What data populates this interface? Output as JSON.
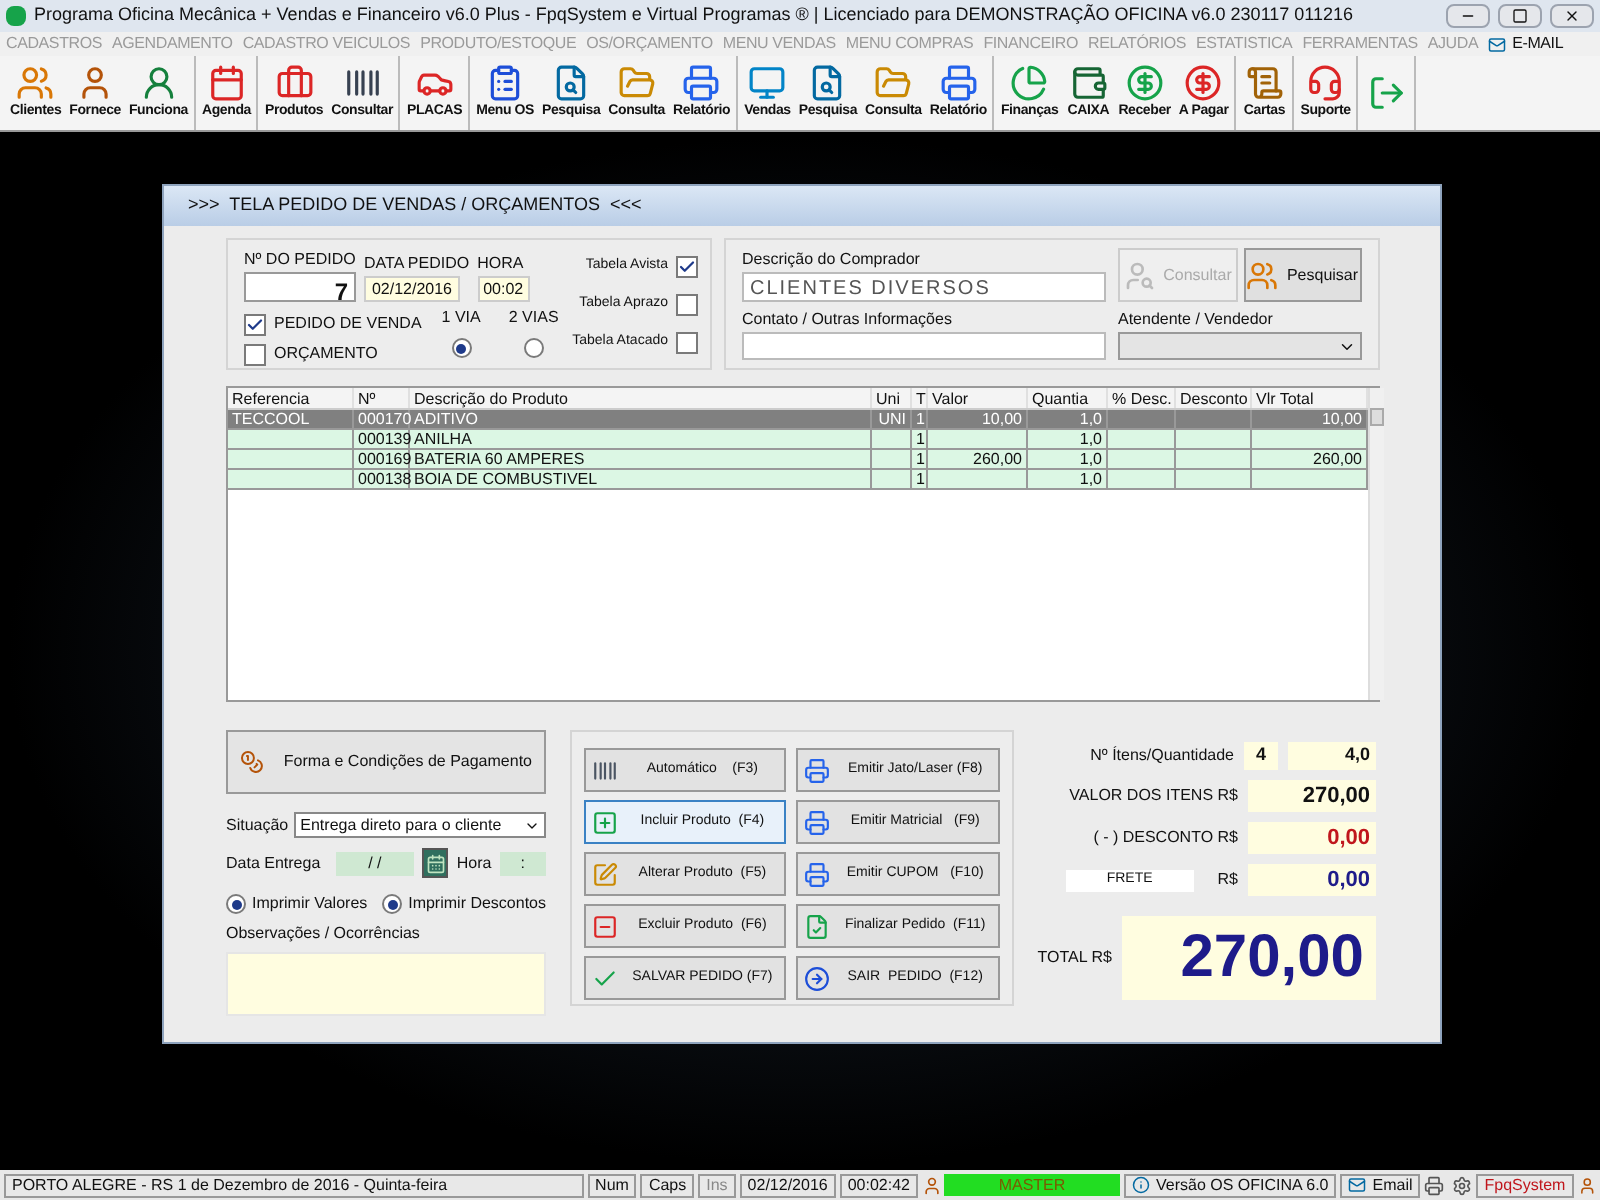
{
  "window": {
    "title": "Programa Oficina Mecânica + Vendas e Financeiro v6.0 Plus - FpqSystem e Virtual Programas ® | Licenciado para  DEMONSTRAÇÃO OFICINA v6.0 230117 011216"
  },
  "menu": [
    "CADASTROS",
    "AGENDAMENTO",
    "CADASTRO VEICULOS",
    "PRODUTO/ESTOQUE",
    "OS/ORÇAMENTO",
    "MENU VENDAS",
    "MENU COMPRAS",
    "FINANCEIRO",
    "RELATÓRIOS",
    "ESTATISTICA",
    "FERRAMENTAS",
    "AJUDA"
  ],
  "menu_email": "E-MAIL",
  "toolbar": [
    {
      "items": [
        {
          "kind": "clients",
          "label": "Clientes"
        },
        {
          "kind": "supplier",
          "label": "Fornece"
        },
        {
          "kind": "employee",
          "label": "Funciona"
        }
      ]
    },
    {
      "items": [
        {
          "kind": "agenda",
          "label": "Agenda"
        }
      ]
    },
    {
      "items": [
        {
          "kind": "products",
          "label": "Produtos"
        },
        {
          "kind": "barcode",
          "label": "Consultar"
        }
      ]
    },
    {
      "items": [
        {
          "kind": "car",
          "label": "PLACAS"
        }
      ]
    },
    {
      "items": [
        {
          "kind": "clipboard",
          "label": "Menu OS"
        },
        {
          "kind": "search",
          "label": "Pesquisa"
        },
        {
          "kind": "folder",
          "label": "Consulta"
        },
        {
          "kind": "printer",
          "label": "Relatório"
        }
      ]
    },
    {
      "items": [
        {
          "kind": "monitor",
          "label": "Vendas"
        },
        {
          "kind": "search",
          "label": "Pesquisa"
        },
        {
          "kind": "folder",
          "label": "Consulta"
        },
        {
          "kind": "printer",
          "label": "Relatório"
        }
      ]
    },
    {
      "items": [
        {
          "kind": "pie",
          "label": "Finanças"
        },
        {
          "kind": "cash",
          "label": "CAIXA"
        },
        {
          "kind": "receive",
          "label": "Receber"
        },
        {
          "kind": "pay",
          "label": "A Pagar"
        }
      ]
    },
    {
      "items": [
        {
          "kind": "scroll",
          "label": "Cartas"
        }
      ]
    },
    {
      "items": [
        {
          "kind": "support",
          "label": "Suporte"
        }
      ]
    },
    {
      "items": [
        {
          "kind": "exit"
        }
      ]
    }
  ],
  "dialog": {
    "title": ">>>  TELA PEDIDO DE VENDAS / ORÇAMENTOS  <<<",
    "order": {
      "number_label": "Nº DO PEDIDO",
      "number": "7",
      "date_label": "DATA PEDIDO",
      "date": "02/12/2016",
      "time_label": "HORA",
      "time": "00:02",
      "types": [
        {
          "label": "PEDIDO DE VENDA",
          "checked": true
        },
        {
          "label": "ORÇAMENTO",
          "checked": false
        }
      ],
      "copies": [
        {
          "label": "1 VIA",
          "selected": true
        },
        {
          "label": "2 VIAS",
          "selected": false
        }
      ],
      "price_tables": [
        {
          "label": "Tabela Avista",
          "checked": true
        },
        {
          "label": "Tabela Aprazo",
          "checked": false
        },
        {
          "label": "Tabela Atacado",
          "checked": false
        }
      ]
    },
    "buyer": {
      "label": "Descrição do Comprador",
      "value": "CLIENTES DIVERSOS",
      "contact_label": "Contato / Outras Informações",
      "seller_label": "Atendente / Vendedor",
      "buttons": [
        {
          "label": "Consultar",
          "disabled": true
        },
        {
          "label": "Pesquisar",
          "disabled": false
        }
      ]
    },
    "table": {
      "columns": [
        "Referencia",
        "Nº",
        "Descrição do Produto",
        "Uni",
        "T",
        "Valor",
        "Quantia",
        "% Desc.",
        "Desconto",
        "Vlr Total"
      ],
      "rows": [
        {
          "selected": true,
          "cells": [
            "TECCOOL",
            "000170",
            "ADITIVO",
            "UNI",
            "1",
            "10,00",
            "1,0",
            "",
            "",
            "10,00"
          ]
        },
        {
          "selected": false,
          "cells": [
            "",
            "000139",
            "ANILHA",
            "",
            "1",
            "",
            "1,0",
            "",
            "",
            ""
          ]
        },
        {
          "selected": false,
          "cells": [
            "",
            "000169",
            "BATERIA 60 AMPERES",
            "",
            "1",
            "260,00",
            "1,0",
            "",
            "",
            "260,00"
          ]
        },
        {
          "selected": false,
          "cells": [
            "",
            "000138",
            "BOIA DE COMBUSTIVEL",
            "",
            "1",
            "",
            "1,0",
            "",
            "",
            ""
          ]
        }
      ]
    },
    "payment_button": "Forma e Condições de Pagamento",
    "situation": {
      "label": "Situação",
      "value": "Entrega direto para o cliente"
    },
    "delivery": {
      "date_label": "Data Entrega",
      "date": "/ /",
      "time_label": "Hora",
      "time": ":"
    },
    "print_options": [
      {
        "label": "Imprimir Valores",
        "selected": true
      },
      {
        "label": "Imprimir Descontos",
        "selected": true
      }
    ],
    "notes_label": "Observações / Ocorrências",
    "actions": [
      {
        "kind": "barcode",
        "label": "Automático    (F3)",
        "focused": false
      },
      {
        "kind": "print",
        "label": "Emitir Jato/Laser (F8)",
        "focused": false
      },
      {
        "kind": "add",
        "label": "Incluir Produto  (F4)",
        "focused": true
      },
      {
        "kind": "print",
        "label": "Emitir Matricial   (F9)",
        "focused": false
      },
      {
        "kind": "edit",
        "label": "Alterar Produto  (F5)",
        "focused": false
      },
      {
        "kind": "print",
        "label": "Emitir CUPOM   (F10)",
        "focused": false
      },
      {
        "kind": "delete",
        "label": "Excluir Produto  (F6)",
        "focused": false
      },
      {
        "kind": "finish",
        "label": "Finalizar Pedido  (F11)",
        "focused": false
      },
      {
        "kind": "save",
        "label": "SALVAR PEDIDO (F7)",
        "focused": false
      },
      {
        "kind": "exit",
        "label": "SAIR  PEDIDO  (F12)",
        "focused": false
      }
    ],
    "totals": {
      "items_label": "Nº Ítens/Quantidade",
      "items": "4",
      "quantity": "4,0",
      "value_label": "VALOR DOS ITENS R$",
      "value": "270,00",
      "discount_label": "( - ) DESCONTO R$",
      "discount": "0,00",
      "freight_label": "FRETE",
      "freight_currency": "R$",
      "freight": "0,00",
      "total_label": "TOTAL R$",
      "total": "270,00"
    }
  },
  "status_bar": [
    {
      "kind": "text",
      "text": "PORTO ALEGRE - RS  1 de Dezembro de 2016 - Quinta-feira"
    },
    {
      "kind": "text",
      "text": "Num"
    },
    {
      "kind": "text",
      "text": "Caps"
    },
    {
      "kind": "off",
      "text": "Ins"
    },
    {
      "kind": "text",
      "text": "02/12/2016"
    },
    {
      "kind": "text",
      "text": "00:02:42"
    },
    {
      "kind": "user",
      "text": "MASTER"
    },
    {
      "kind": "version",
      "text": "Versão OS OFICINA 6.0"
    },
    {
      "kind": "email",
      "text": "Email"
    },
    {
      "kind": "tools"
    },
    {
      "kind": "brand",
      "text": "FpqSystem"
    },
    {
      "kind": "end"
    }
  ]
}
